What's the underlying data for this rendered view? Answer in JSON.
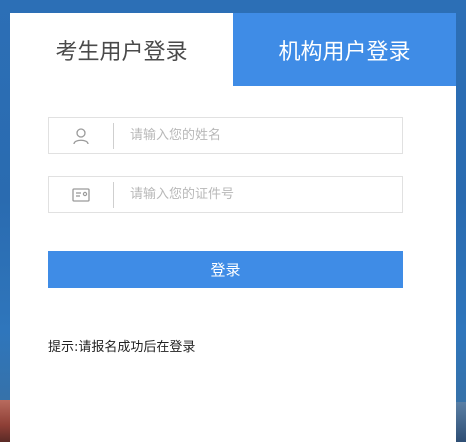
{
  "tabs": [
    {
      "label": "考生用户登录",
      "active": false
    },
    {
      "label": "机构用户登录",
      "active": true
    }
  ],
  "form": {
    "name_placeholder": "请输入您的姓名",
    "id_placeholder": "请输入您的证件号",
    "name_icon": "user-icon",
    "id_icon": "id-card-icon"
  },
  "login_button": "登录",
  "hint": "提示:请报名成功后在登录",
  "colors": {
    "accent": "#3f8ce6",
    "background": "#2c6fb6"
  }
}
